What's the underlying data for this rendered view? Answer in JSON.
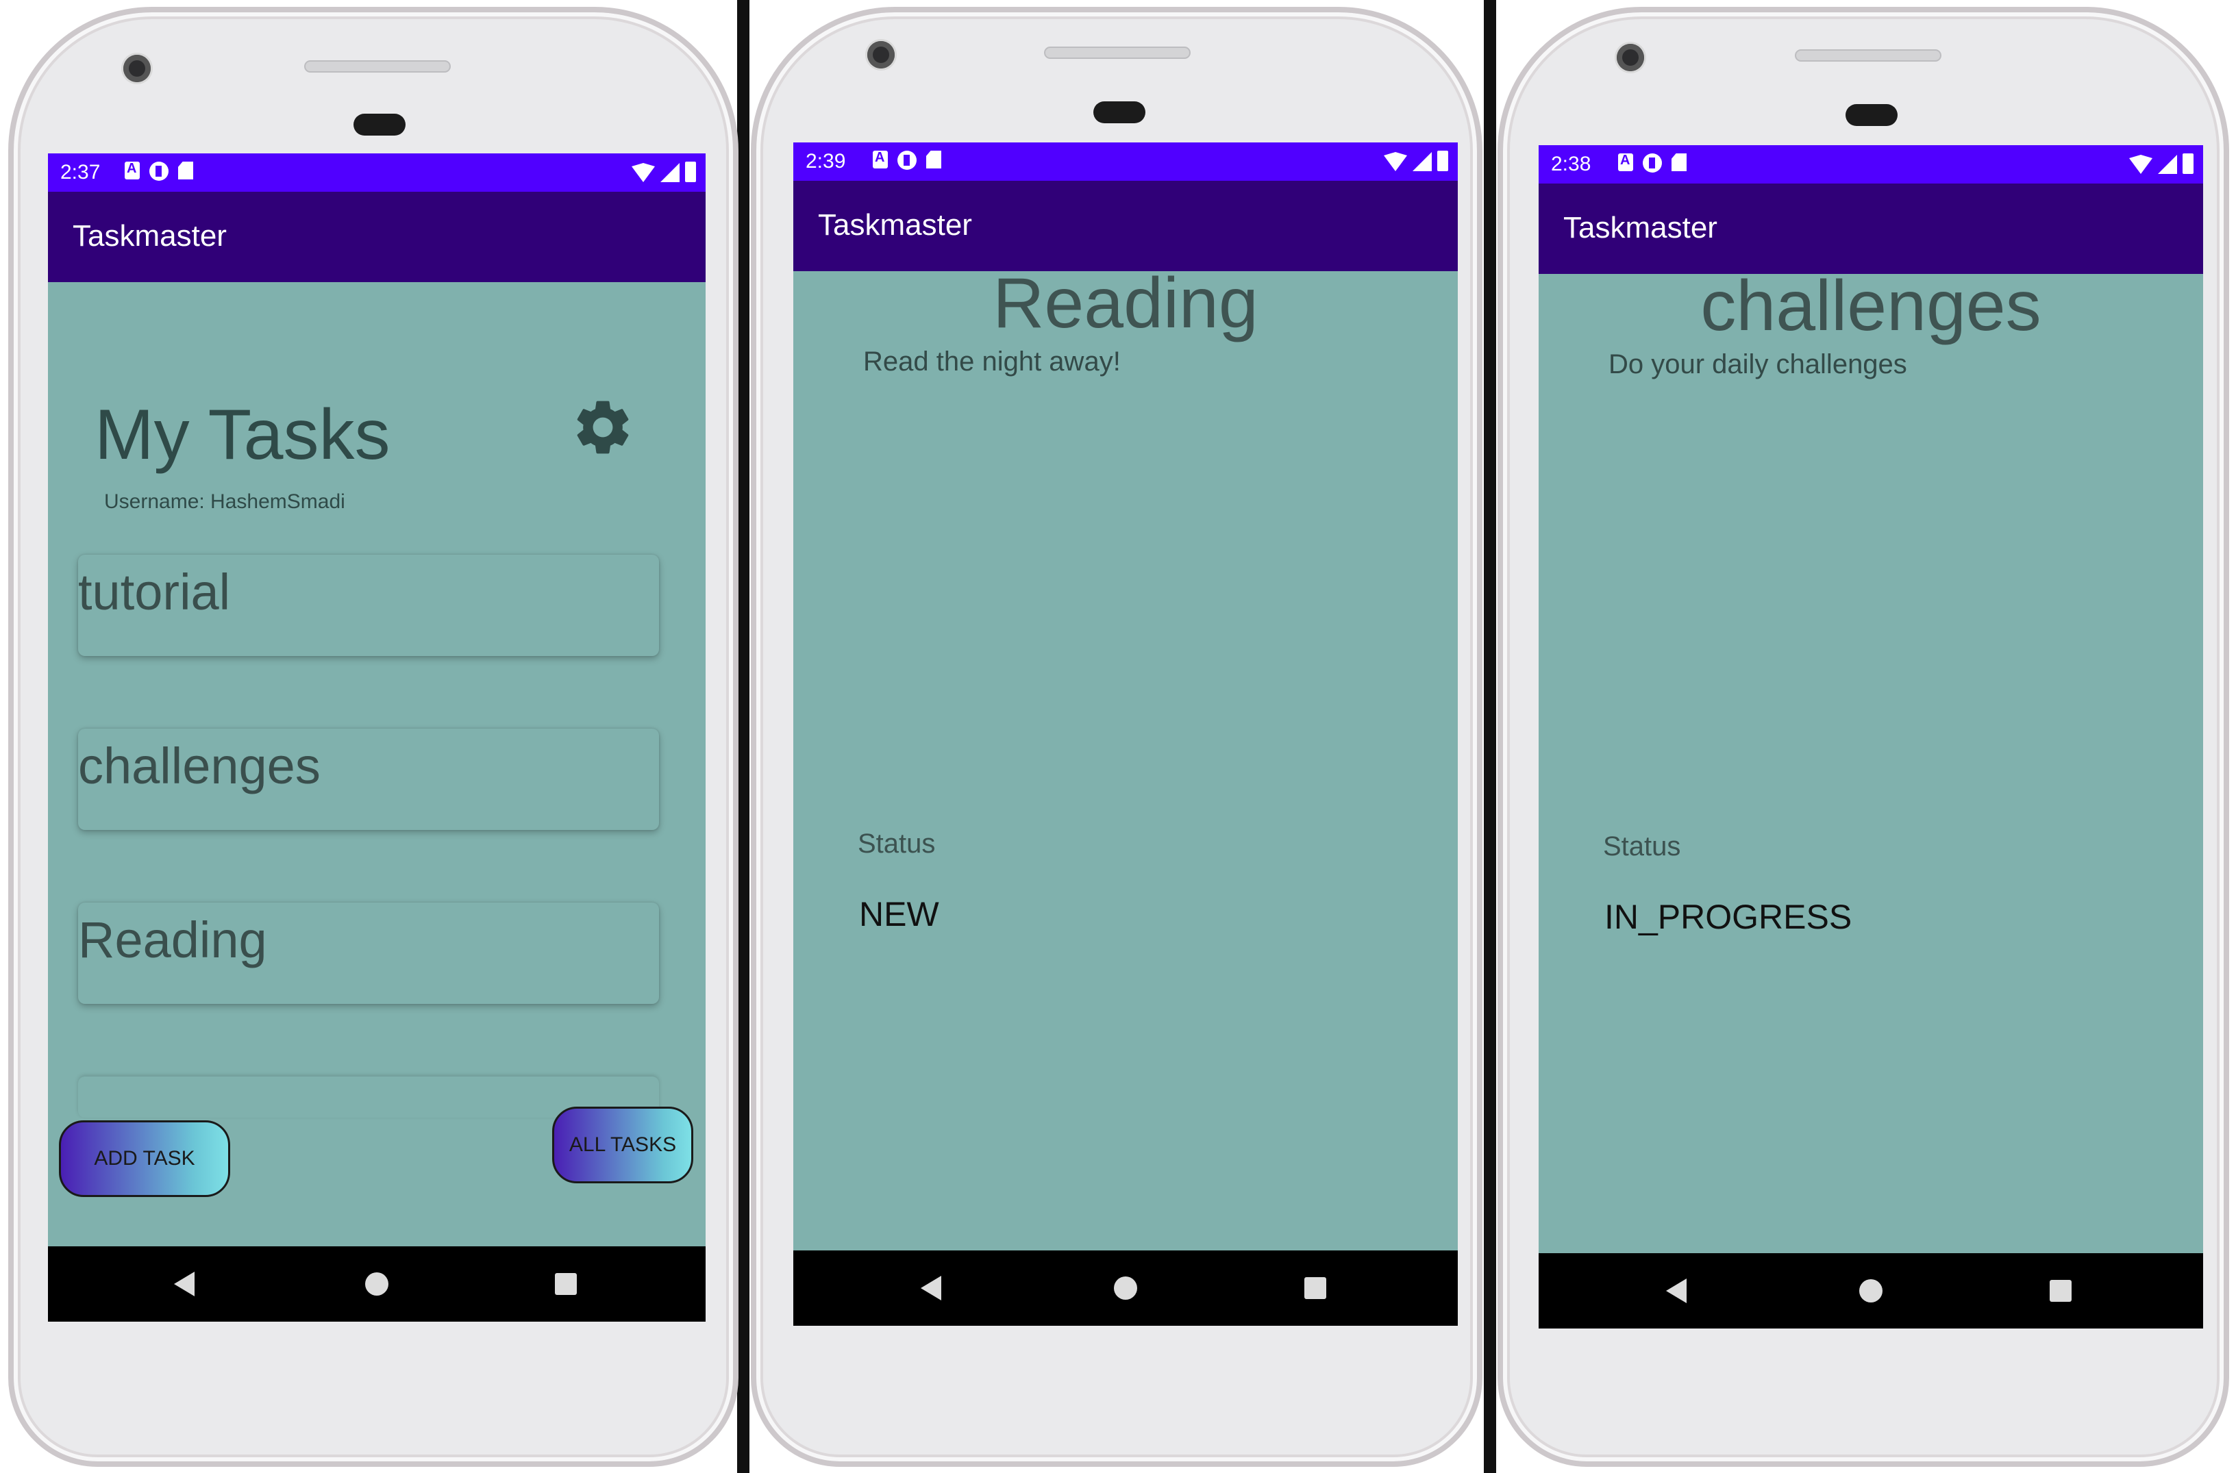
{
  "colors": {
    "status_bar": "#5000ff",
    "app_bar": "#300078",
    "screen_bg": "#80b1ad",
    "nav_bar": "#000000"
  },
  "phones": [
    {
      "status_time": "2:37",
      "app_title": "Taskmaster",
      "heading": "My Tasks",
      "settings_icon": "gear-icon",
      "username_label": "Username: HashemSmadi",
      "tasks": [
        "tutorial",
        "challenges",
        "Reading"
      ],
      "add_task_button": "ADD TASK",
      "all_tasks_button": "ALL TASKS"
    },
    {
      "status_time": "2:39",
      "app_title": "Taskmaster",
      "task_title": "Reading",
      "task_body": "Read the night away!",
      "status_label": "Status",
      "status_value": "NEW"
    },
    {
      "status_time": "2:38",
      "app_title": "Taskmaster",
      "task_title": "challenges",
      "task_body": "Do your daily challenges",
      "status_label": "Status",
      "status_value": "IN_PROGRESS"
    }
  ]
}
